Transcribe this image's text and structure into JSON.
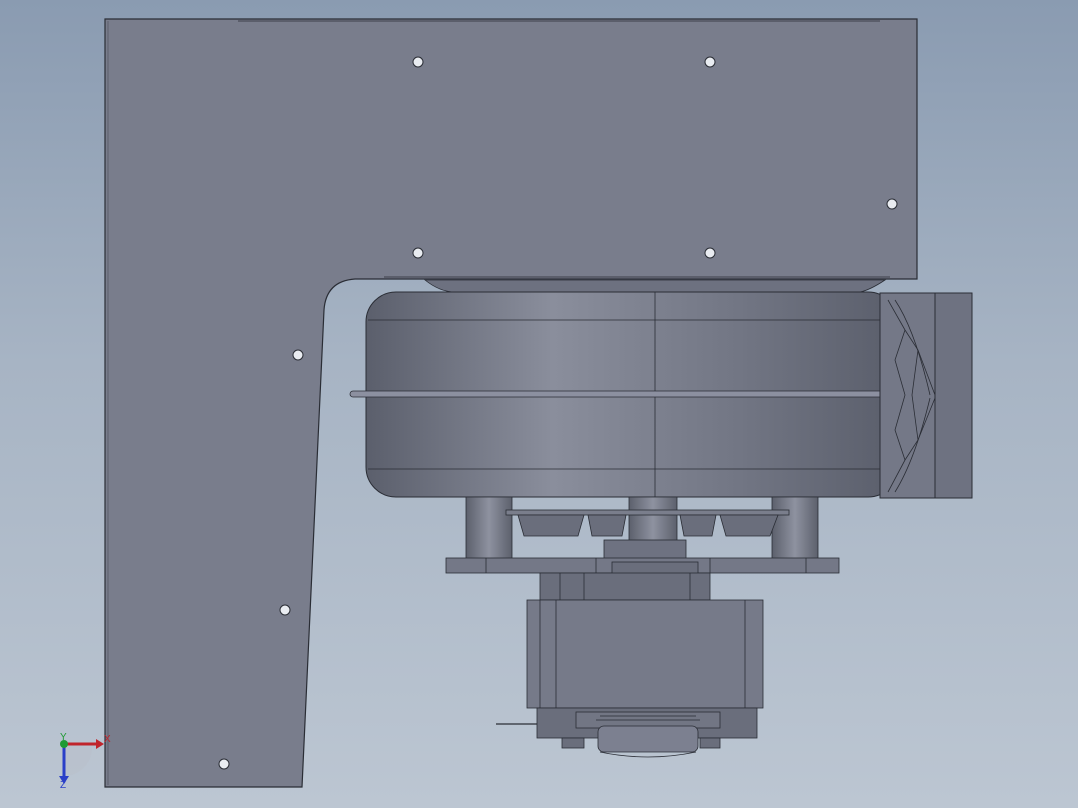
{
  "view": {
    "background_top": "#8a9bb1",
    "background_bottom": "#bcc6d2",
    "part_color": "#7b7f8e",
    "edge_color": "#2c2f38"
  },
  "triad": {
    "x_label": "X",
    "y_label": "Y",
    "z_label": "Z",
    "x_color": "#c0242b",
    "y_color": "#1f9a34",
    "z_color": "#2a3fc8"
  }
}
